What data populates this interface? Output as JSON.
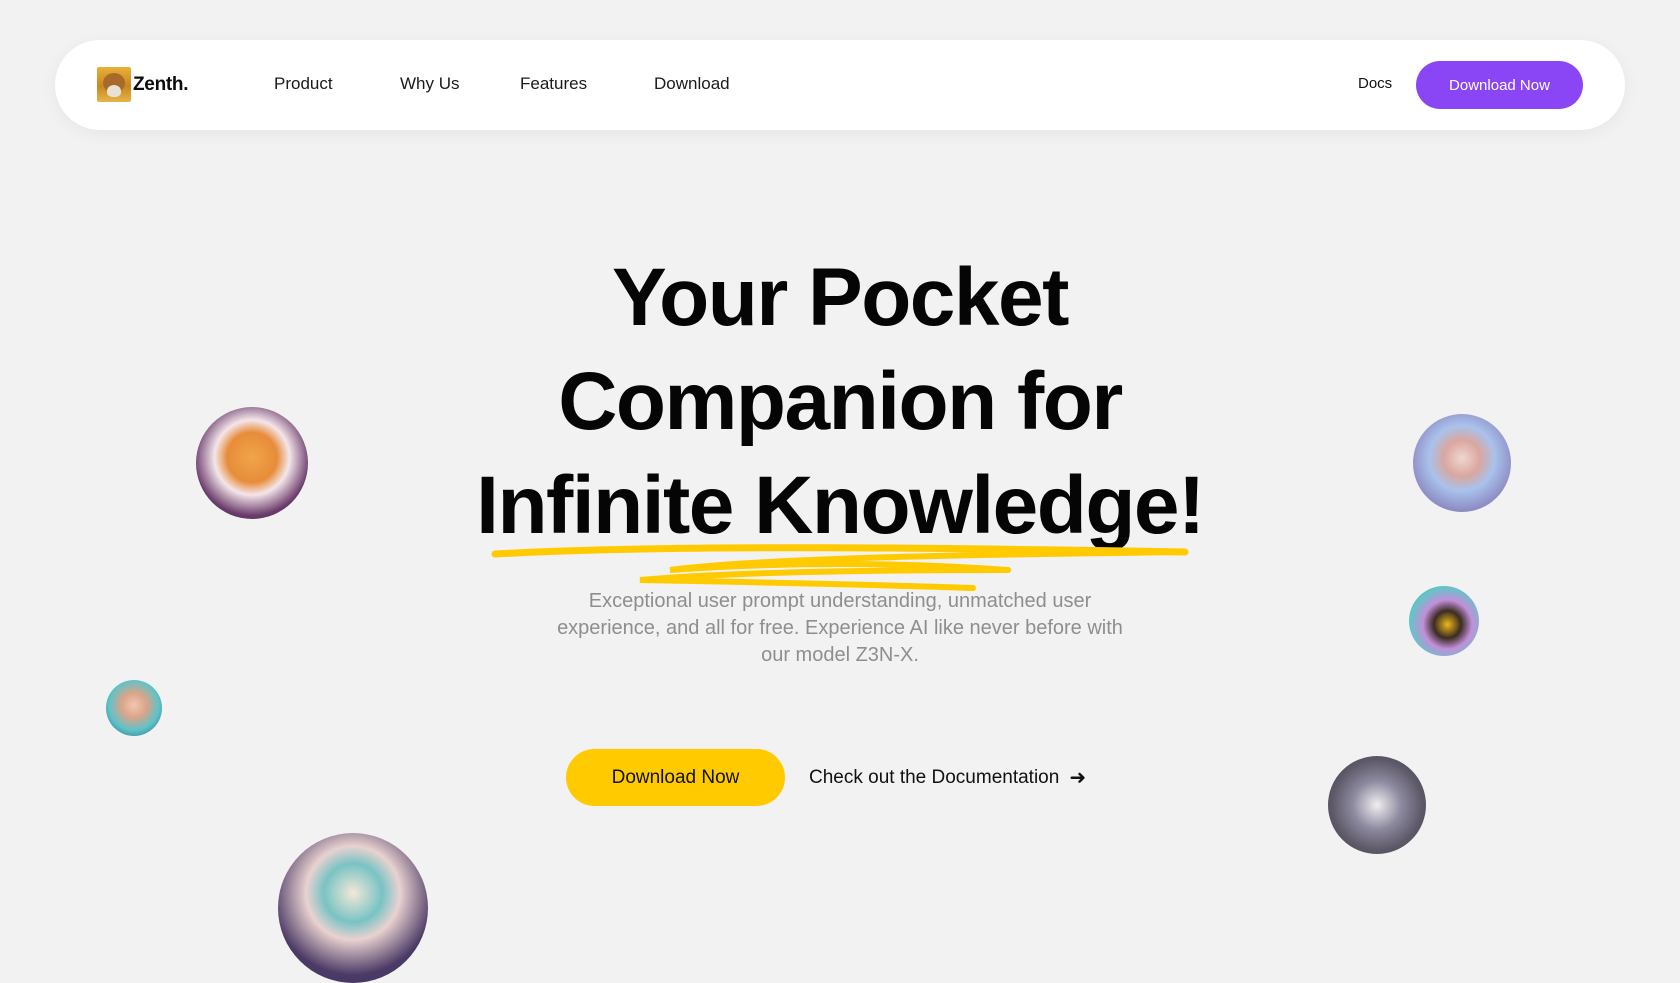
{
  "nav": {
    "brand": "Zenth.",
    "links": [
      "Product",
      "Why Us",
      "Features",
      "Download"
    ],
    "docs_label": "Docs",
    "cta_label": "Download Now"
  },
  "hero": {
    "headline_lines": [
      "Your Pocket",
      "Companion for",
      "Infinite Knowledge!"
    ],
    "subtitle": "Exceptional user prompt understanding, unmatched user experience, and all for free. Experience AI like never before with our model Z3N-X.",
    "primary_cta": "Download Now",
    "secondary_cta": "Check out the Documentation",
    "secondary_icon": "arrow-right-icon"
  },
  "avatars": [
    {
      "name": "fox-avatar"
    },
    {
      "name": "kitten-avatar"
    },
    {
      "name": "horned-creature-avatar"
    },
    {
      "name": "fluffy-blue-avatar"
    },
    {
      "name": "bee-avatar"
    },
    {
      "name": "cat-avatar"
    }
  ],
  "colors": {
    "background": "#f2f2f2",
    "nav_bg": "#ffffff",
    "accent_purple": "#8a45f5",
    "accent_yellow": "#ffcb00",
    "subtitle_gray": "#8e8e8e"
  }
}
